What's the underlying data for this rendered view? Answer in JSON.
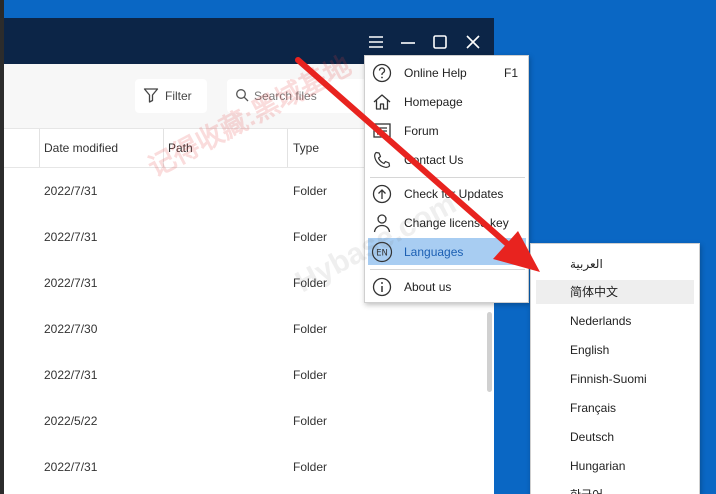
{
  "toolbar": {
    "filter_label": "Filter",
    "search_placeholder": "Search files"
  },
  "table": {
    "columns": [
      "Date modified",
      "Path",
      "Type"
    ],
    "rows": [
      {
        "date": "2022/7/31",
        "type": "Folder"
      },
      {
        "date": "2022/7/31",
        "type": "Folder"
      },
      {
        "date": "2022/7/31",
        "type": "Folder"
      },
      {
        "date": "2022/7/30",
        "type": "Folder"
      },
      {
        "date": "2022/7/31",
        "type": "Folder"
      },
      {
        "date": "2022/5/22",
        "type": "Folder"
      },
      {
        "date": "2022/7/31",
        "type": "Folder"
      }
    ]
  },
  "menu": {
    "items": [
      {
        "label": "Online Help",
        "shortcut": "F1",
        "icon": "help-icon"
      },
      {
        "label": "Homepage",
        "icon": "home-icon"
      },
      {
        "label": "Forum",
        "icon": "forum-icon"
      },
      {
        "label": "Contact Us",
        "icon": "phone-icon"
      },
      {
        "label": "Check for Updates",
        "icon": "update-icon"
      },
      {
        "label": "Change license key",
        "icon": "user-icon"
      },
      {
        "label": "Languages",
        "icon": "language-icon",
        "icon_text": "EN"
      },
      {
        "label": "About us",
        "icon": "info-icon"
      }
    ]
  },
  "languages": {
    "items": [
      "العربية",
      "简体中文",
      "Nederlands",
      "English",
      "Finnish-Suomi",
      "Français",
      "Deutsch",
      "Hungarian",
      "한국어"
    ]
  },
  "watermark": {
    "text": "记得收藏:黑域基地",
    "text2": "Hybase.com"
  },
  "colors": {
    "desktop": "#0a67c4",
    "titlebar": "#0c2547",
    "menu_active": "#a8cdf2",
    "arrow": "#e8231f"
  }
}
